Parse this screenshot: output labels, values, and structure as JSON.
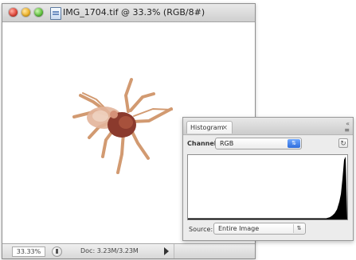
{
  "document_window": {
    "title": "IMG_1704.tif @ 33.3% (RGB/8#)",
    "zoom_level": "33.33%",
    "doc_size": "Doc: 3.23M/3.23M"
  },
  "histogram_panel": {
    "tab_label": "Histogram",
    "tab_close": "×",
    "collapse_label": "«",
    "panel_menu": "≡",
    "channel_label": "Channel:",
    "channel_value": "RGB",
    "channel_arrows": "⇅",
    "refresh": "↻",
    "source_label": "Source:",
    "source_value": "Entire Image",
    "source_arrows": "⇅"
  },
  "icons": {
    "close": "close-window-icon",
    "minimize": "minimize-window-icon",
    "zoom": "zoom-window-icon",
    "document": "document-icon",
    "status": "status-icon",
    "menu_arrow": "play-arrow-icon",
    "panel_menu": "panel-menu-icon",
    "refresh": "refresh-icon"
  },
  "colors": {
    "title_text": "#222222",
    "spider_body": "#8b3a2d",
    "spider_legs": "#d29a71",
    "histogram_fill": "#000000"
  }
}
